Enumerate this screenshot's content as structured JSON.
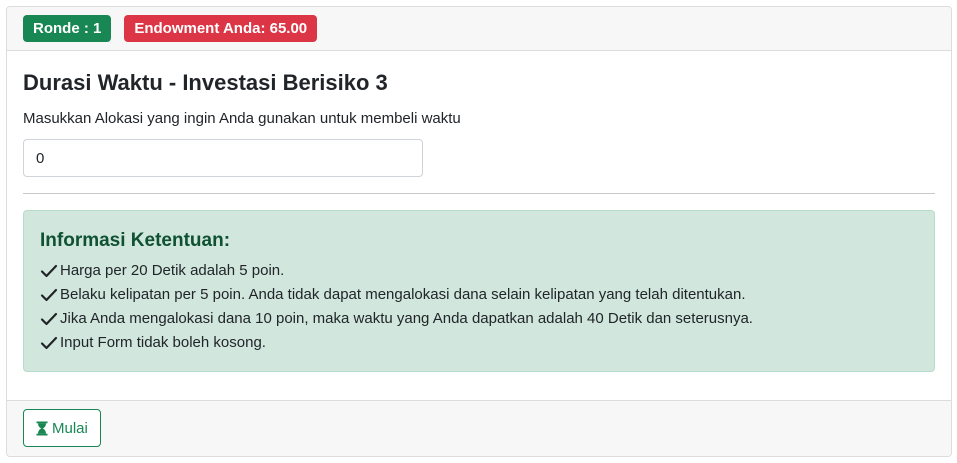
{
  "header": {
    "round_badge": "Ronde : 1",
    "endowment_badge": "Endowment Anda: 65.00"
  },
  "main": {
    "title": "Durasi Waktu - Investasi Berisiko 3",
    "input_label": "Masukkan Alokasi yang ingin Anda gunakan untuk membeli waktu",
    "input_value": "0"
  },
  "info": {
    "title": "Informasi Ketentuan:",
    "rules": [
      "Harga per 20 Detik adalah 5 poin.",
      "Belaku kelipatan per 5 poin. Anda tidak dapat mengalokasi dana selain kelipatan yang telah ditentukan.",
      "Jika Anda mengalokasi dana 10 poin, maka waktu yang Anda dapatkan adalah 40 Detik dan seterusnya.",
      "Input Form tidak boleh kosong."
    ]
  },
  "footer": {
    "start_label": "Mulai",
    "start_icon": "hourglass-icon"
  },
  "colors": {
    "success": "#198754",
    "danger": "#dc3545",
    "alert_bg": "#d1e7dd",
    "alert_text": "#0f5132"
  }
}
